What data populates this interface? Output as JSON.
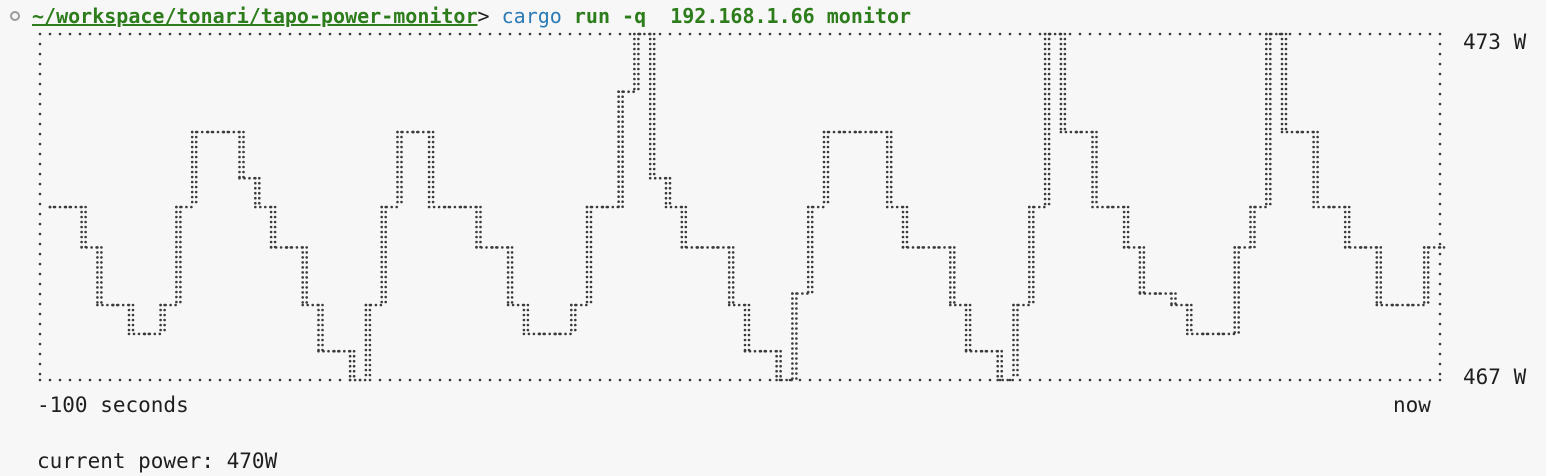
{
  "terminal": {
    "cwd": "~/workspace/tonari/tapo-power-monitor",
    "prompt_symbol": ">",
    "command": "cargo",
    "args": "run -q  192.168.1.66 monitor"
  },
  "chart_data": {
    "type": "line",
    "y_max_label": "473 W",
    "y_min_label": "467 W",
    "x_start_label": "-100 seconds",
    "x_end_label": "now",
    "ylim": [
      467,
      473
    ],
    "xlim": [
      -100,
      0
    ],
    "series": [
      {
        "values": [
          470,
          470,
          469.3,
          468.3,
          468.3,
          467.8,
          467.8,
          468.3,
          470,
          471.3,
          471.3,
          471.3,
          470.5,
          470,
          469.3,
          469.3,
          468.3,
          467.5,
          467.5,
          467,
          468.3,
          470,
          471.3,
          471.3,
          470,
          470,
          470,
          469.3,
          469.3,
          468.3,
          467.8,
          467.8,
          467.8,
          468.3,
          470,
          470,
          472,
          473,
          470.5,
          470,
          469.3,
          469.3,
          469.3,
          468.3,
          467.5,
          467.5,
          467,
          468.5,
          470,
          471.3,
          471.3,
          471.3,
          471.3,
          470,
          469.3,
          469.3,
          469.3,
          468.3,
          467.5,
          467.5,
          467,
          468.3,
          470,
          473,
          471.3,
          471.3,
          470,
          470,
          469.3,
          468.5,
          468.5,
          468.3,
          467.8,
          467.8,
          467.8,
          469.3,
          470,
          473,
          471.3,
          471.3,
          470,
          470,
          469.3,
          469.3,
          468.3,
          468.3,
          468.3,
          469.3,
          469.3
        ]
      }
    ],
    "colors": {
      "trace": "#3a3a3a"
    }
  },
  "status": {
    "current_power": "current power: 470W"
  }
}
